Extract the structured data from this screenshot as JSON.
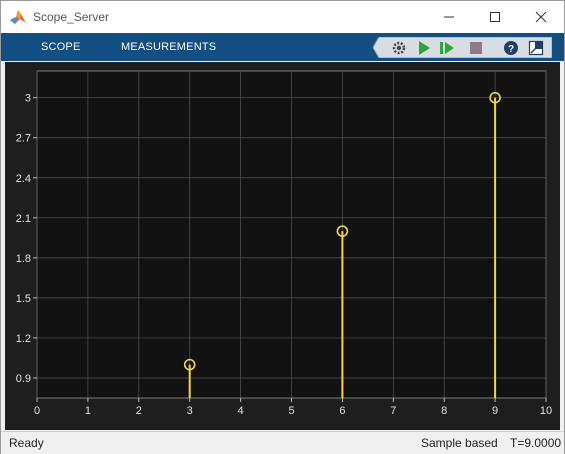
{
  "window": {
    "title": "Scope_Server",
    "controls": [
      "minimize-icon",
      "maximize-icon",
      "close-icon"
    ]
  },
  "toolstrip": {
    "tabs": [
      {
        "label": "SCOPE"
      },
      {
        "label": "MEASUREMENTS"
      }
    ],
    "tools": [
      "settings-gear-icon",
      "run-icon",
      "step-forward-icon",
      "stop-icon",
      "help-icon",
      "undock-icon"
    ]
  },
  "status": {
    "left": "Ready",
    "mode": "Sample based",
    "time": "T=9.0000"
  },
  "colors": {
    "toolstrip": "#134e82",
    "plot_bg": "#121212",
    "grid": "#555555",
    "stem": "#f5d24a",
    "tick_text": "#e0e0e0"
  },
  "chart_data": {
    "type": "stem",
    "x": [
      3,
      6,
      9
    ],
    "y": [
      1,
      2,
      3
    ],
    "xlim": [
      0,
      10
    ],
    "ylim": [
      0.75,
      3.2
    ],
    "xticks": [
      0,
      1,
      2,
      3,
      4,
      5,
      6,
      7,
      8,
      9,
      10
    ],
    "yticks": [
      0.9,
      1.2,
      1.5,
      1.8,
      2.1,
      2.4,
      2.7,
      3
    ],
    "xlabel": "",
    "ylabel": "",
    "title": "",
    "grid": true,
    "marker": "circle"
  }
}
